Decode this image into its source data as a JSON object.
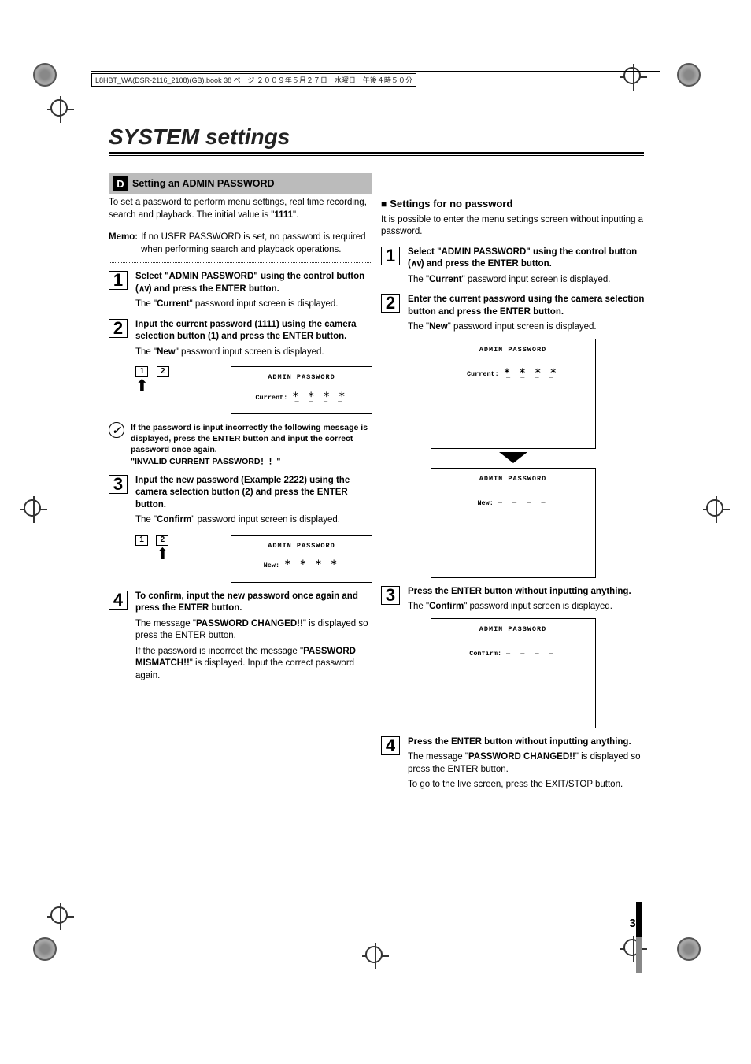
{
  "header_line": "L8HBT_WA(DSR-2116_2108)(GB).book  38 ページ  ２００９年５月２７日　水曜日　午後４時５０分",
  "page_title": "SYSTEM settings",
  "section": {
    "badge": "D",
    "title": "Setting an ADMIN PASSWORD"
  },
  "page_num": "38",
  "left": {
    "intro_1": "To set a password to perform menu settings, real time recording, search and playback. The initial value is \"",
    "intro_bold": "1111",
    "intro_2": "\".",
    "memo_label": "Memo:",
    "memo_body": "If no USER PASSWORD is set, no password is required when performing search and playback operations.",
    "s1_lead_a": "Select \"",
    "s1_lead_b": "ADMIN PASSWORD",
    "s1_lead_c": "\" using the control button (",
    "s1_lead_d": ") and press the ENTER button.",
    "s1_sub_a": "The \"",
    "s1_sub_b": "Current",
    "s1_sub_c": "\" password input screen is displayed.",
    "s2_lead": "Input the current password (1111) using the camera selection button (1) and press the ENTER button.",
    "s2_sub_a": "The \"",
    "s2_sub_b": "New",
    "s2_sub_c": "\" password input screen is displayed.",
    "warn1": "If the password is input incorrectly the following message is displayed, press the ENTER button and input the correct password once again.",
    "warn2": "\"INVALID CURRENT PASSWORD！！\"",
    "s3_lead": "Input the new password (Example 2222) using the camera selection button (2) and press the ENTER button.",
    "s3_sub_a": "The \"",
    "s3_sub_b": "Confirm",
    "s3_sub_c": "\" password input screen is displayed.",
    "s4_lead": "To confirm, input the new password once again and press the ENTER button.",
    "s4_sub_a": "The message \"",
    "s4_sub_b": "PASSWORD CHANGED!!",
    "s4_sub_c": "\" is displayed so press the ENTER button.",
    "s4_sub_d": "If the password is incorrect the message \"",
    "s4_sub_e": "PASSWORD MISMATCH!!",
    "s4_sub_f": "\" is displayed. Input the correct password again.",
    "screen1": {
      "title": "ADMIN PASSWORD",
      "label": "Current:",
      "value": "＊ ＊ ＊ ＊",
      "under": "_ _ _ _"
    },
    "screen2": {
      "title": "ADMIN PASSWORD",
      "label": "New:",
      "value": "＊ ＊ ＊ ＊",
      "under": "_ _ _ _"
    },
    "btn1": "1",
    "btn2": "2"
  },
  "right": {
    "subhead": "Settings for no password",
    "intro": "It is possible to enter the menu settings screen without inputting a password.",
    "s1_lead_a": "Select \"",
    "s1_lead_b": "ADMIN PASSWORD",
    "s1_lead_c": "\" using the control button (",
    "s1_lead_d": ") and press the ENTER button.",
    "s1_sub_a": "The \"",
    "s1_sub_b": "Current",
    "s1_sub_c": "\" password input screen is displayed.",
    "s2_lead": "Enter the current password using the camera selection button and press the ENTER button.",
    "s2_sub_a": "The \"",
    "s2_sub_b": "New",
    "s2_sub_c": "\" password input screen is displayed.",
    "s3_lead": "Press the ENTER button without inputting anything.",
    "s3_sub_a": "The \"",
    "s3_sub_b": "Confirm",
    "s3_sub_c": "\" password input screen is displayed.",
    "s4_lead": "Press the ENTER button without inputting anything.",
    "s4_sub_a": "The message \"",
    "s4_sub_b": "PASSWORD CHANGED!!",
    "s4_sub_c": "\" is displayed so press the ENTER button.",
    "s4_sub_d": "To go to the live screen, press the EXIT/STOP button.",
    "screenA": {
      "title": "ADMIN PASSWORD",
      "label": "Current:",
      "value": "＊ ＊ ＊ ＊",
      "under": "_ _ _ _"
    },
    "screenB": {
      "title": "ADMIN PASSWORD",
      "label": "New:",
      "value": "",
      "under": "_ _ _ _"
    },
    "screenC": {
      "title": "ADMIN PASSWORD",
      "label": "Confirm:",
      "value": "",
      "under": "_ _ _ _"
    }
  }
}
